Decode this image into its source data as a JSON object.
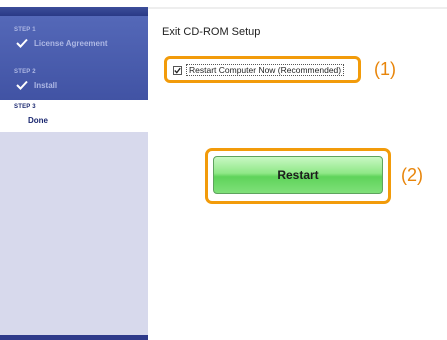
{
  "sidebar": {
    "steps": [
      {
        "number": "STEP 1",
        "label": "License Agreement",
        "state": "done",
        "icon": "check-icon"
      },
      {
        "number": "STEP 2",
        "label": "Install",
        "state": "done",
        "icon": "check-icon"
      },
      {
        "number": "STEP 3",
        "label": "Done",
        "state": "current"
      }
    ]
  },
  "main": {
    "title": "Exit CD-ROM Setup",
    "restart_checkbox": {
      "label": "Restart Computer Now (Recommended)",
      "checked": true
    },
    "callout_1": "(1)",
    "restart_button": "Restart",
    "callout_2": "(2)"
  },
  "colors": {
    "sidebar_bg": "#d7d9ec",
    "sidebar_header": "#4153a4",
    "highlight_frame": "#f29b0a",
    "callout_text": "#e8850a",
    "button_green": "#5fd35a"
  }
}
